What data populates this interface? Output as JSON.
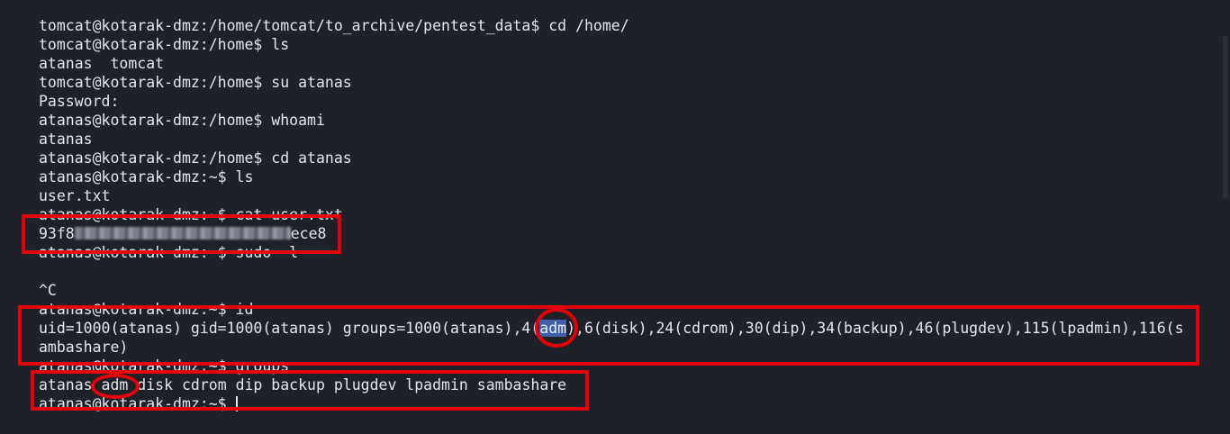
{
  "terminal": {
    "lines": [
      "tomcat@kotarak-dmz:/home/tomcat/to_archive/pentest_data$ cd /home/",
      "tomcat@kotarak-dmz:/home$ ls",
      "atanas  tomcat",
      "tomcat@kotarak-dmz:/home$ su atanas",
      "Password:",
      "atanas@kotarak-dmz:/home$ whoami",
      "atanas",
      "atanas@kotarak-dmz:/home$ cd atanas",
      "atanas@kotarak-dmz:~$ ls",
      "user.txt",
      "atanas@kotarak-dmz:~$ cat user.txt",
      "",
      "atanas@kotarak-dmz:~$ sudo -l",
      "",
      "^C",
      "atanas@kotarak-dmz:~$ id",
      "",
      "ambashare)",
      "atanas@kotarak-dmz:~$ groups",
      "",
      "atanas@kotarak-dmz:~$ "
    ],
    "flag_prefix": "93f8",
    "flag_suffix": "ece8",
    "id_before": "uid=1000(atanas) gid=1000(atanas) groups=1000(atanas),4(",
    "id_adm": "adm",
    "id_after": "),6(disk),24(cdrom),30(dip),34(backup),46(plugdev),115(lpadmin),116(s",
    "groups_before": "atanas ",
    "groups_adm": "adm",
    "groups_after": " disk cdrom dip backup plugdev lpadmin sambashare",
    "annotation_color": "#e3000b"
  }
}
